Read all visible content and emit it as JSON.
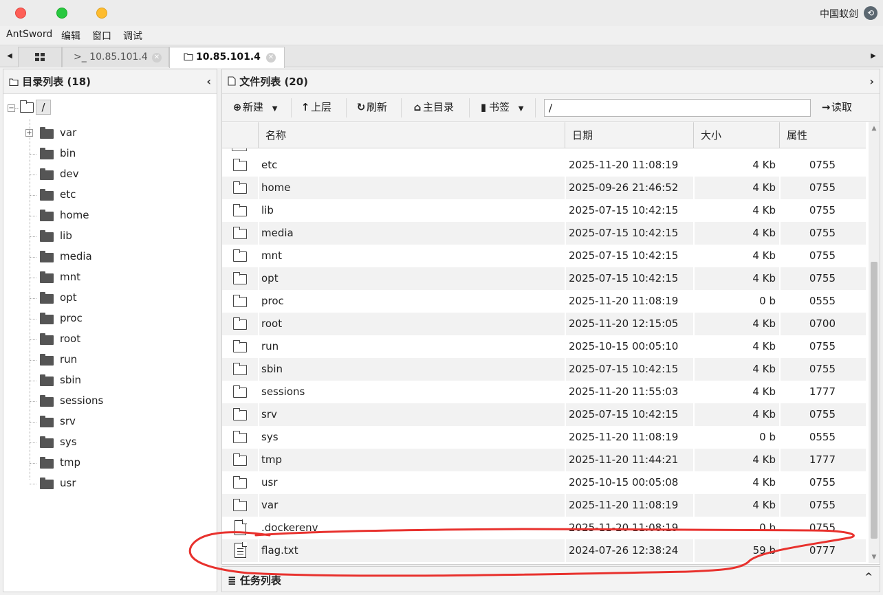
{
  "titlebar": {
    "brand": "中国蚁剑"
  },
  "menu": [
    "AntSword",
    "编辑",
    "窗口",
    "调试"
  ],
  "tabs": [
    {
      "label": ">_ 10.85.101.4"
    },
    {
      "label": "10.85.101.4"
    }
  ],
  "left_panel": {
    "title": "目录列表 (18)",
    "root": "/",
    "items": [
      "var",
      "bin",
      "dev",
      "etc",
      "home",
      "lib",
      "media",
      "mnt",
      "opt",
      "proc",
      "root",
      "run",
      "sbin",
      "sessions",
      "srv",
      "sys",
      "tmp",
      "usr"
    ]
  },
  "right_panel": {
    "title": "文件列表 (20)",
    "toolbar": {
      "new": "新建",
      "up": "上层",
      "refresh": "刷新",
      "home": "主目录",
      "bookmarks": "书签",
      "path": "/",
      "read": "读取"
    },
    "columns": [
      "名称",
      "日期",
      "大小",
      "属性"
    ],
    "rows": [
      {
        "name": "etc",
        "date": "2025-11-20 11:08:19",
        "size": "4 Kb",
        "attr": "0755",
        "type": "folder"
      },
      {
        "name": "home",
        "date": "2025-09-26 21:46:52",
        "size": "4 Kb",
        "attr": "0755",
        "type": "folder"
      },
      {
        "name": "lib",
        "date": "2025-07-15 10:42:15",
        "size": "4 Kb",
        "attr": "0755",
        "type": "folder"
      },
      {
        "name": "media",
        "date": "2025-07-15 10:42:15",
        "size": "4 Kb",
        "attr": "0755",
        "type": "folder"
      },
      {
        "name": "mnt",
        "date": "2025-07-15 10:42:15",
        "size": "4 Kb",
        "attr": "0755",
        "type": "folder"
      },
      {
        "name": "opt",
        "date": "2025-07-15 10:42:15",
        "size": "4 Kb",
        "attr": "0755",
        "type": "folder"
      },
      {
        "name": "proc",
        "date": "2025-11-20 11:08:19",
        "size": "0 b",
        "attr": "0555",
        "type": "folder"
      },
      {
        "name": "root",
        "date": "2025-11-20 12:15:05",
        "size": "4 Kb",
        "attr": "0700",
        "type": "folder"
      },
      {
        "name": "run",
        "date": "2025-10-15 00:05:10",
        "size": "4 Kb",
        "attr": "0755",
        "type": "folder"
      },
      {
        "name": "sbin",
        "date": "2025-07-15 10:42:15",
        "size": "4 Kb",
        "attr": "0755",
        "type": "folder"
      },
      {
        "name": "sessions",
        "date": "2025-11-20 11:55:03",
        "size": "4 Kb",
        "attr": "1777",
        "type": "folder"
      },
      {
        "name": "srv",
        "date": "2025-07-15 10:42:15",
        "size": "4 Kb",
        "attr": "0755",
        "type": "folder"
      },
      {
        "name": "sys",
        "date": "2025-11-20 11:08:19",
        "size": "0 b",
        "attr": "0555",
        "type": "folder"
      },
      {
        "name": "tmp",
        "date": "2025-11-20 11:44:21",
        "size": "4 Kb",
        "attr": "1777",
        "type": "folder"
      },
      {
        "name": "usr",
        "date": "2025-10-15 00:05:08",
        "size": "4 Kb",
        "attr": "0755",
        "type": "folder"
      },
      {
        "name": "var",
        "date": "2025-11-20 11:08:19",
        "size": "4 Kb",
        "attr": "0755",
        "type": "folder"
      },
      {
        "name": ".dockerenv",
        "date": "2025-11-20 11:08:19",
        "size": "0 b",
        "attr": "0755",
        "type": "file"
      },
      {
        "name": "flag.txt",
        "date": "2024-07-26 12:38:24",
        "size": "59 b",
        "attr": "0777",
        "type": "text"
      }
    ]
  },
  "task_panel": {
    "title": "任务列表"
  },
  "colors": {
    "annotation": "#e8312d"
  }
}
